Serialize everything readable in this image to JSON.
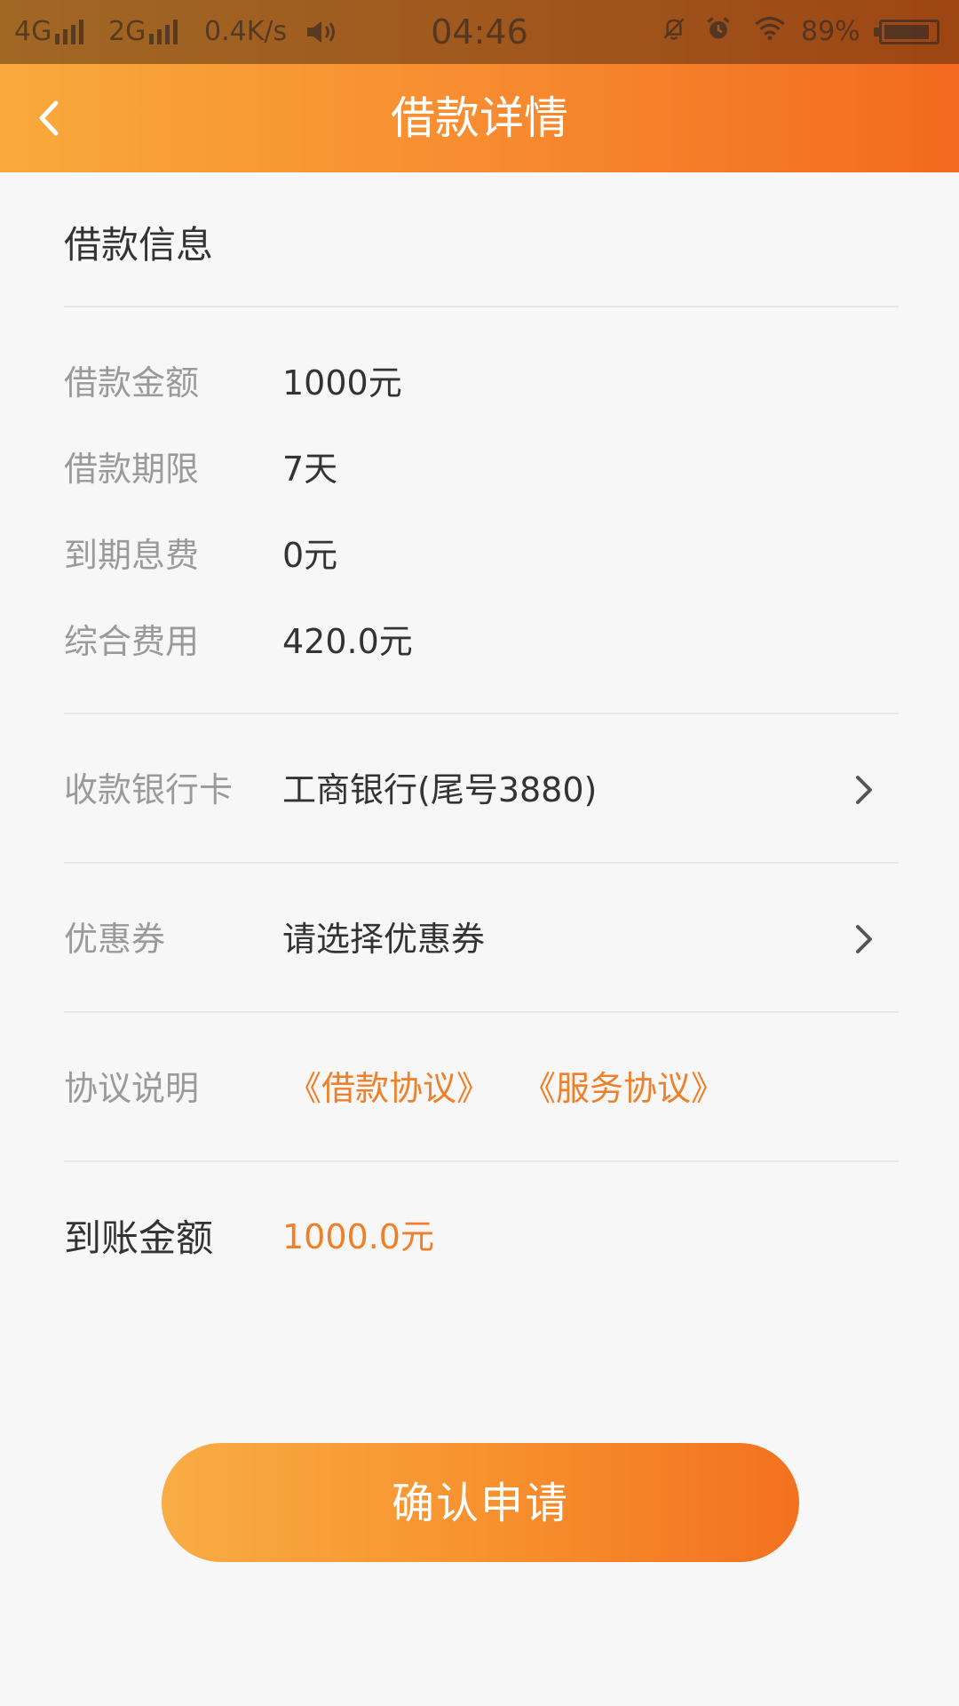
{
  "status_bar": {
    "network_1": "4G",
    "network_2": "2G",
    "speed": "0.4K/s",
    "time": "04:46",
    "battery": "89%",
    "battery_level": 0.89,
    "icons": [
      "signal-icon",
      "signal-icon",
      "speaker-icon",
      "bell-off-icon",
      "alarm-icon",
      "wifi-icon",
      "battery-icon"
    ]
  },
  "header": {
    "title": "借款详情",
    "back_icon": "chevron-left-icon"
  },
  "loan_info": {
    "section_title": "借款信息",
    "rows": [
      {
        "label": "借款金额",
        "value": "1000元"
      },
      {
        "label": "借款期限",
        "value": "7天"
      },
      {
        "label": "到期息费",
        "value": "0元"
      },
      {
        "label": "综合费用",
        "value": "420.0元"
      }
    ]
  },
  "bank_card": {
    "label": "收款银行卡",
    "value": "工商银行(尾号3880)"
  },
  "coupon": {
    "label": "优惠券",
    "value": "请选择优惠券"
  },
  "agreements": {
    "label": "协议说明",
    "loan_agreement": "《借款协议》",
    "service_agreement": "《服务协议》"
  },
  "arrival": {
    "label": "到账金额",
    "value": "1000.0元"
  },
  "confirm_button": {
    "label": "确认申请"
  },
  "colors": {
    "accent": "#f07f2a",
    "gradient_start": "#f9a93c",
    "gradient_end": "#f26a1f"
  }
}
